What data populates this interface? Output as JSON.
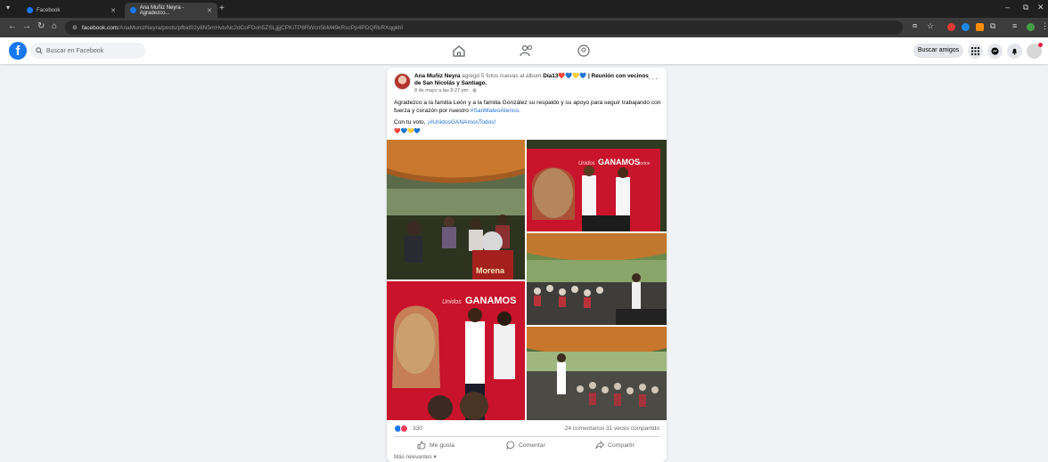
{
  "browser": {
    "tabs": [
      {
        "title": "Facebook"
      },
      {
        "title": "Ana Muñiz Neyra - Agradezco..."
      }
    ],
    "address": {
      "host": "facebook.com",
      "path": "/AnaMunizNeyra/posts/pfbid02y8N5mHvtvNc2dCoFDoh5ZSLjjjjCPKiTP8RWcn5bM49kRscPp4PDQRkRXqgkhl"
    }
  },
  "facebook": {
    "search_placeholder": "Buscar en Facebook",
    "find_friends": "Buscar amigos",
    "brand_color": "#1877f2"
  },
  "post": {
    "author": "Ana Muñiz Neyra",
    "action": "agregó 5 fotos nuevas al álbum",
    "album": "Día13",
    "album_emojis": "❤️💙💛💙",
    "album_rest": "| Reunión con vecinos de San Nicolás y Santiago.",
    "time": "8 de mayo a las 8:27 pm ·",
    "body": "Agradezco a la familia León y a la familia González su respaldo y su apoyo para seguir trabajando con fuerza y corazón por nuestro",
    "body_hashtag": "#SanMateoAtenco.",
    "second_line_prefix": "Con tu voto,",
    "second_line_hashtag": "¡#UnidosGANAmosTodos!",
    "emojis": "❤️💙💛💙",
    "reaction_count": "330",
    "comments_shares": "24 comentarios   31 veces compartido",
    "actions": {
      "like": "Me gusta",
      "comment": "Comentar",
      "share": "Compartir"
    },
    "sort_label": "Más relevantes ▾",
    "photo_texts": {
      "banner_word": "GANAMOS",
      "banner_prefix": "Unidos",
      "banner_suffix": "todos",
      "shirt_text": "Morena"
    }
  }
}
